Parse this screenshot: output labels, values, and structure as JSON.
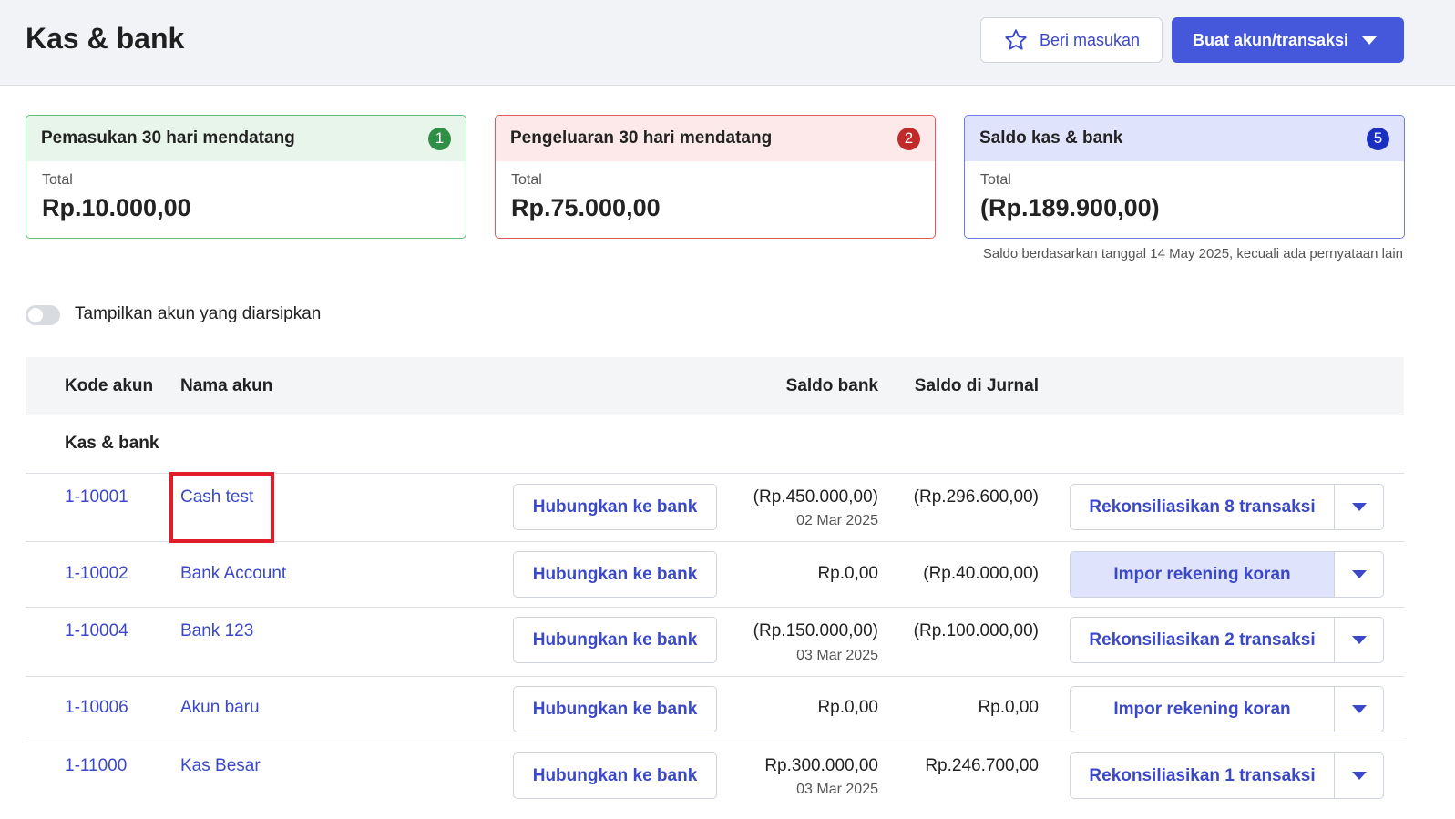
{
  "header": {
    "title": "Kas & bank",
    "feedback_label": "Beri masukan",
    "create_label": "Buat akun/transaksi"
  },
  "cards": [
    {
      "title": "Pemasukan 30 hari mendatang",
      "badge": "1",
      "total_label": "Total",
      "total_value": "Rp.10.000,00"
    },
    {
      "title": "Pengeluaran 30 hari mendatang",
      "badge": "2",
      "total_label": "Total",
      "total_value": "Rp.75.000,00"
    },
    {
      "title": "Saldo kas & bank",
      "badge": "5",
      "total_label": "Total",
      "total_value": "(Rp.189.900,00)"
    }
  ],
  "balance_note": "Saldo berdasarkan tanggal 14 May 2025, kecuali ada pernyataan lain",
  "archived_toggle": {
    "label": "Tampilkan akun yang diarsipkan",
    "on": false
  },
  "table": {
    "headers": {
      "code": "Kode akun",
      "name": "Nama akun",
      "bank_balance": "Saldo bank",
      "journal_balance": "Saldo di Jurnal"
    },
    "group_label": "Kas & bank",
    "rows": [
      {
        "code": "1-10001",
        "name": "Cash test",
        "link_label": "Hubungkan ke bank",
        "bank_balance": "(Rp.450.000,00)",
        "bank_date": "02 Mar 2025",
        "journal_balance": "(Rp.296.600,00)",
        "action_label": "Rekonsiliasikan 8 transaksi"
      },
      {
        "code": "1-10002",
        "name": "Bank Account",
        "link_label": "Hubungkan ke bank",
        "bank_balance": "Rp.0,00",
        "bank_date": "",
        "journal_balance": "(Rp.40.000,00)",
        "action_label": "Impor rekening koran"
      },
      {
        "code": "1-10004",
        "name": "Bank 123",
        "link_label": "Hubungkan ke bank",
        "bank_balance": "(Rp.150.000,00)",
        "bank_date": "03 Mar 2025",
        "journal_balance": "(Rp.100.000,00)",
        "action_label": "Rekonsiliasikan 2 transaksi"
      },
      {
        "code": "1-10006",
        "name": "Akun baru",
        "link_label": "Hubungkan ke bank",
        "bank_balance": "Rp.0,00",
        "bank_date": "",
        "journal_balance": "Rp.0,00",
        "action_label": "Impor rekening koran"
      },
      {
        "code": "1-11000",
        "name": "Kas Besar",
        "link_label": "Hubungkan ke bank",
        "bank_balance": "Rp.300.000,00",
        "bank_date": "03 Mar 2025",
        "journal_balance": "Rp.246.700,00",
        "action_label": "Rekonsiliasikan 1 transaksi"
      }
    ]
  },
  "colors": {
    "accent": "#4558dc",
    "link": "#3b48c8",
    "highlight": "#e11d2a"
  }
}
